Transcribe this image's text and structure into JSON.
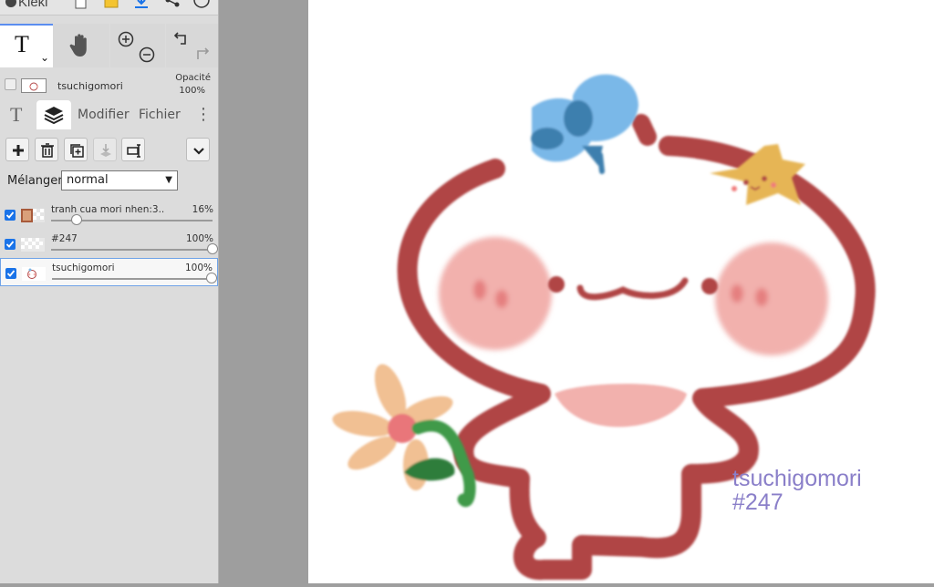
{
  "app": {
    "name": "Kleki"
  },
  "toolbar_icons": [
    "new-file-icon",
    "open-folder-icon",
    "download-icon",
    "share-icon",
    "help-icon"
  ],
  "tools": {
    "text_tool": {
      "glyph": "T",
      "dropdown": "⌄"
    },
    "icons": [
      "hand-icon",
      "zoom-in-icon",
      "zoom-out-icon",
      "undo-icon",
      "redo-icon"
    ]
  },
  "current_layer": {
    "name": "tsuchigomori",
    "opacity_label": "Opacité",
    "opacity_value": "100%"
  },
  "tabs": {
    "text": "T",
    "modify": "Modifier",
    "file": "Fichier",
    "more": "⋮"
  },
  "layer_buttons": [
    "add-layer-icon",
    "delete-layer-icon",
    "duplicate-layer-icon",
    "merge-down-icon",
    "rename-layer-icon",
    "expand-icon"
  ],
  "blend": {
    "label": "Mélanger",
    "value": "normal"
  },
  "layers": [
    {
      "name": "tranh cua mori nhen:3..",
      "opacity": "16%",
      "level": 0.16,
      "checked": true
    },
    {
      "name": "#247",
      "opacity": "100%",
      "level": 1.0,
      "checked": true
    },
    {
      "name": "tsuchigomori",
      "opacity": "100%",
      "level": 1.0,
      "checked": true,
      "selected": true
    }
  ],
  "canvas": {
    "signature_line1": "tsuchigomori",
    "signature_line2": "#247",
    "colors": {
      "outline": "#b04545",
      "cheek": "#f2b1ad",
      "bow": "#7ab8e8",
      "star": "#e6b555",
      "petal": "#f1c093",
      "stem": "#3f9a4a",
      "signature": "#8a7fc9"
    }
  }
}
